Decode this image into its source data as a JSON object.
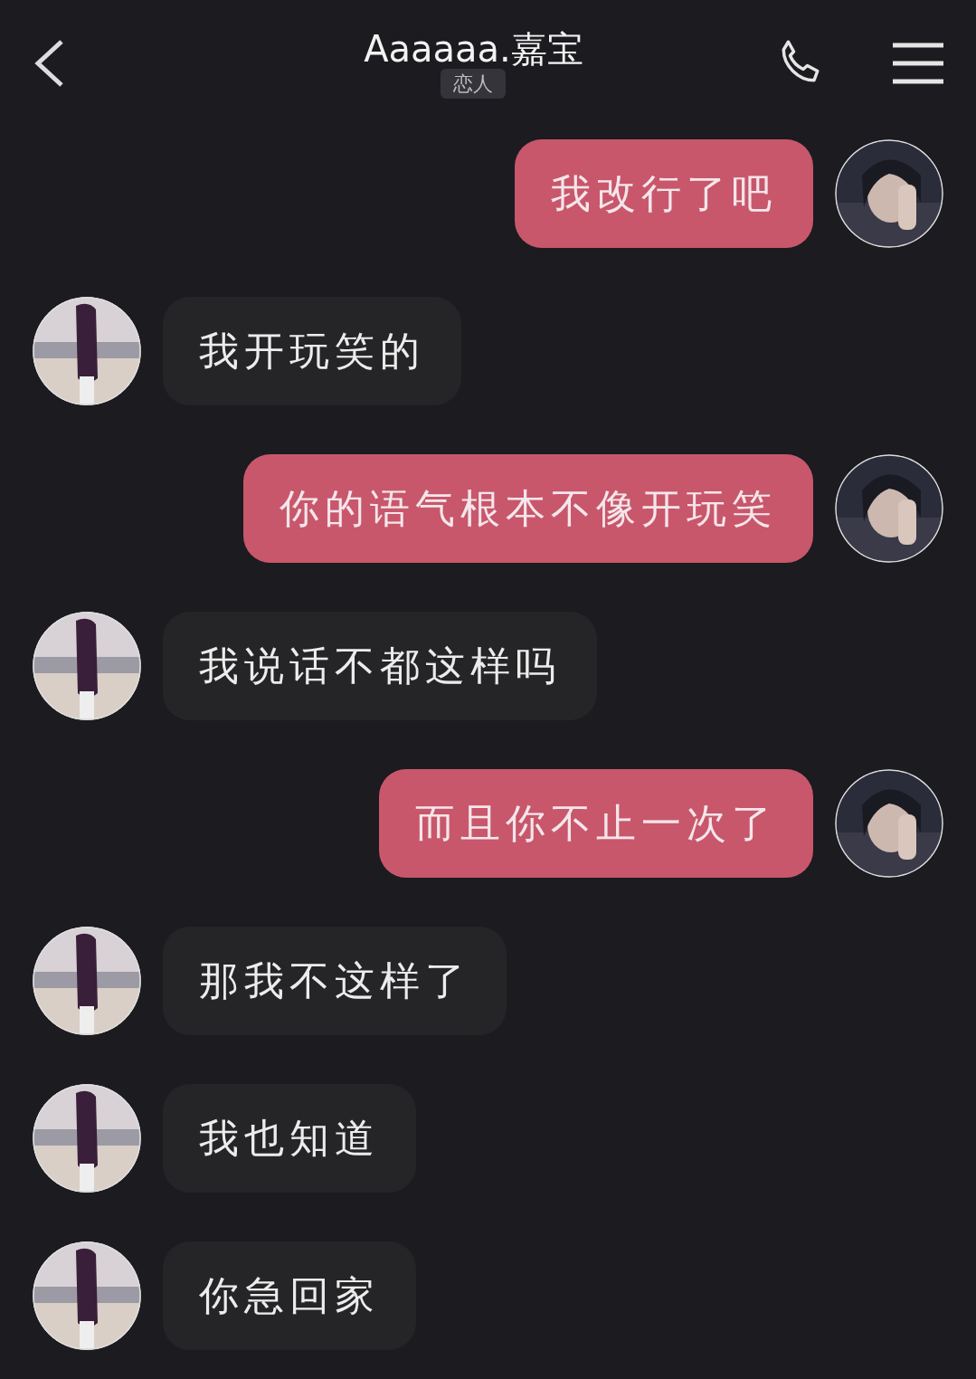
{
  "header": {
    "title": "Aaaaaa.嘉宝",
    "tag": "恋人"
  },
  "messages": [
    {
      "kind": "sent",
      "text": "我改行了吧"
    },
    {
      "kind": "received",
      "text": "我开玩笑的"
    },
    {
      "kind": "sent",
      "text": "你的语气根本不像开玩笑"
    },
    {
      "kind": "received",
      "text": "我说话不都这样吗"
    },
    {
      "kind": "sent",
      "text": "而且你不止一次了"
    },
    {
      "kind": "received",
      "text": "那我不这样了"
    },
    {
      "kind": "received",
      "text": "我也知道"
    },
    {
      "kind": "received",
      "text": "你急回家"
    }
  ]
}
